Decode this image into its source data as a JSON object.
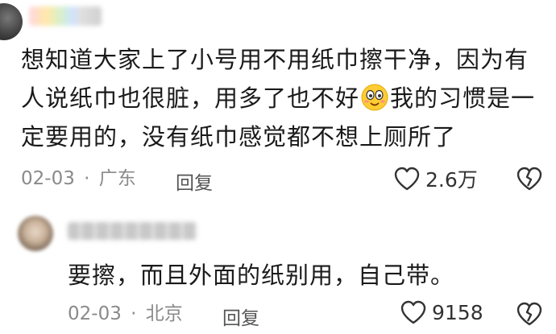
{
  "comment": {
    "username": "LLL",
    "text_part1": "想知道大家上了小号用不用纸巾擦干净，因为有人说纸巾也很脏，用多了也不好",
    "emoji": "smiley-emoji",
    "text_part2": "我的习惯是一定要用的，没有纸巾感觉都不想上厕所了",
    "date": "02-03",
    "separator": "·",
    "location": "广东",
    "reply_label": "回复",
    "like_count": "2.6万"
  },
  "reply": {
    "text": "要擦，而且外面的纸别用，自己带。",
    "date": "02-03",
    "separator": "·",
    "location": "北京",
    "reply_label": "回复",
    "like_count": "9158"
  },
  "colors": {
    "meta": "#8a8a8a",
    "text": "#1a1a1a",
    "emoji_face": "#ffcc33"
  }
}
